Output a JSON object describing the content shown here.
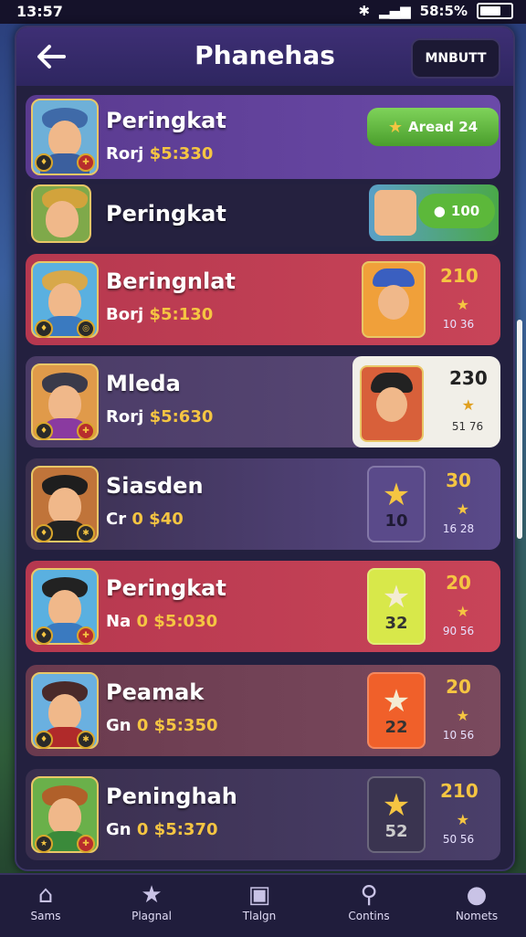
{
  "status": {
    "time": "13:57",
    "battery": "58:5%"
  },
  "header": {
    "title": "Phanehas",
    "right_button": "MNBUTT"
  },
  "rows": [
    {
      "name": "Peringkat",
      "sub_prefix": "Rorj",
      "sub_value": "$5:330",
      "action": "Aread 24"
    },
    {
      "name": "Peringkat",
      "action": "100"
    },
    {
      "name": "Beringnlat",
      "sub_prefix": "Borj",
      "sub_value": "$5:130",
      "score": "210",
      "pct": "10 36"
    },
    {
      "name": "Mleda",
      "sub_prefix": "Rorj",
      "sub_value": "$5:630",
      "score": "230",
      "pct": "51 76"
    },
    {
      "name": "Siasden",
      "sub_prefix": "Cr",
      "sub_value": "0 $40",
      "score": "30",
      "tile": "10",
      "pct": "16 28"
    },
    {
      "name": "Peringkat",
      "sub_prefix": "Na",
      "sub_value": "0 $5:030",
      "score": "20",
      "tile": "32",
      "pct": "90 56"
    },
    {
      "name": "Peamak",
      "sub_prefix": "Gn",
      "sub_value": "0 $5:350",
      "score": "20",
      "tile": "22",
      "pct": "10 56"
    },
    {
      "name": "Peninghah",
      "sub_prefix": "Gn",
      "sub_value": "0 $5:370",
      "score": "210",
      "tile": "52",
      "pct": "50 56"
    }
  ],
  "nav": [
    "Sams",
    "Plagnal",
    "Tlalgn",
    "Contins",
    "Nomets"
  ],
  "colors": {
    "accent_green": "#5cb83a",
    "gold": "#f5c542",
    "panel": "#23203f"
  }
}
